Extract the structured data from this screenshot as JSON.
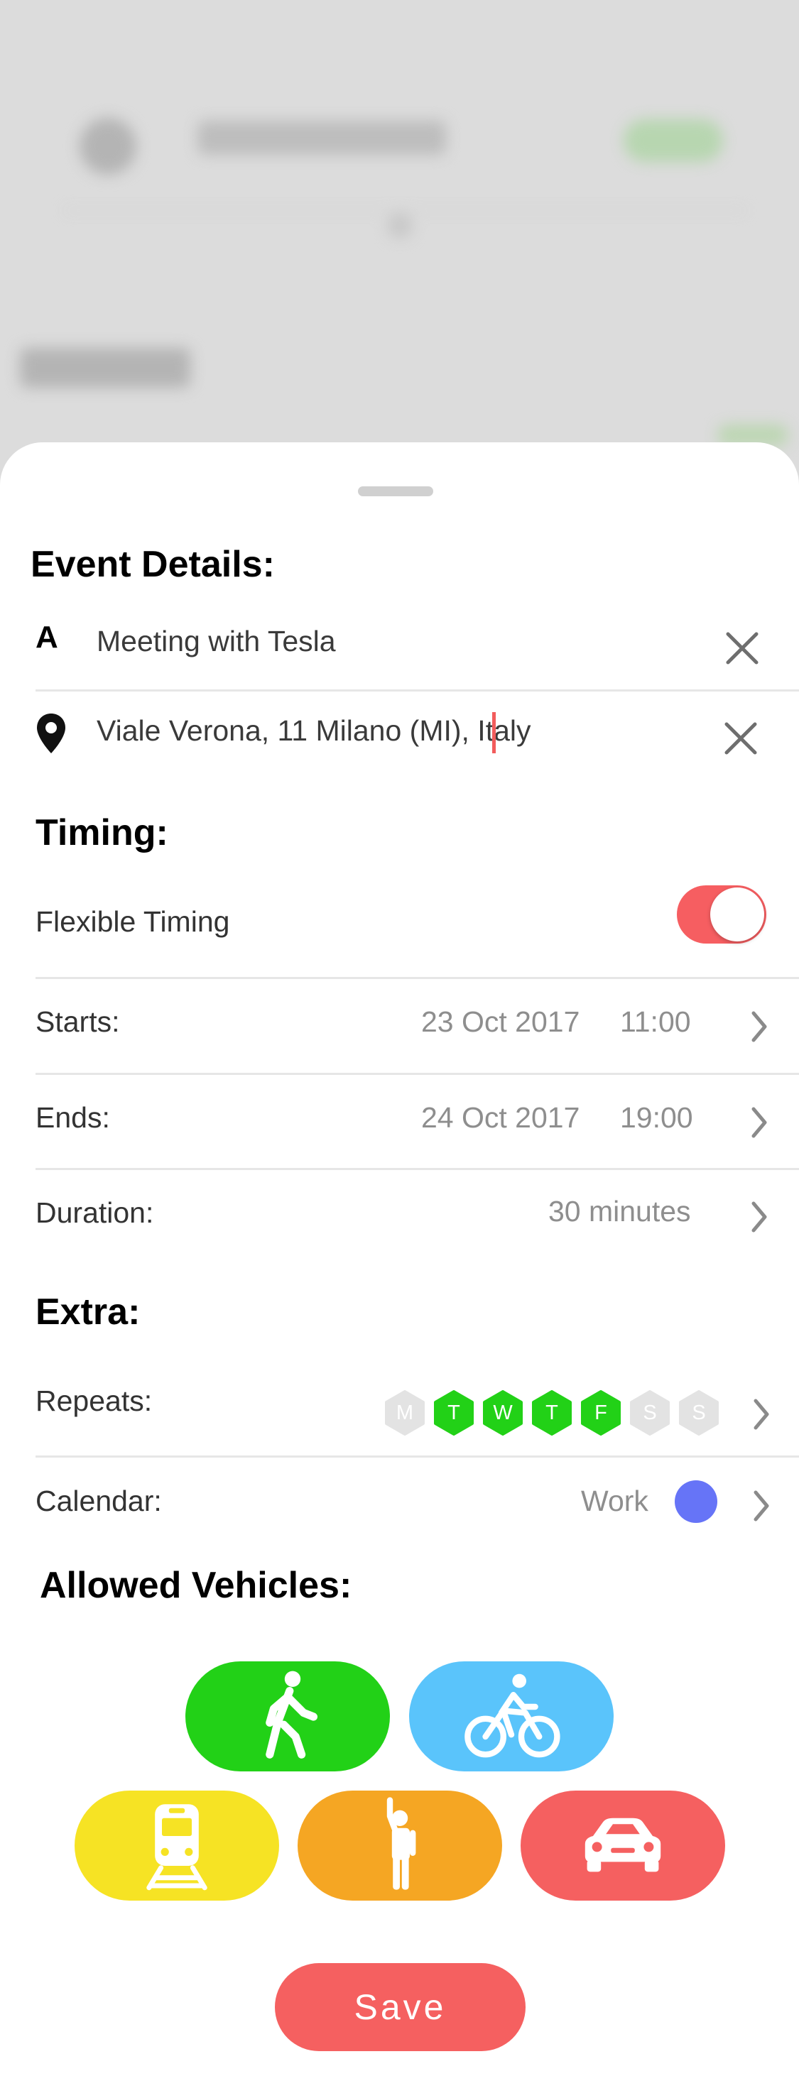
{
  "event_details": {
    "title": "Event Details:",
    "name_icon": "A",
    "name_value": "Meeting with Tesla",
    "location_value": "Viale Verona, 11 Milano (MI), Italy"
  },
  "timing": {
    "title": "Timing:",
    "flexible_label": "Flexible Timing",
    "flexible_on": true,
    "starts_label": "Starts:",
    "starts_date": "23 Oct 2017",
    "starts_time": "11:00",
    "ends_label": "Ends:",
    "ends_date": "24 Oct 2017",
    "ends_time": "19:00",
    "duration_label": "Duration:",
    "duration_value": "30 minutes"
  },
  "extra": {
    "title": "Extra:",
    "repeats_label": "Repeats:",
    "days": [
      {
        "letter": "M",
        "active": false
      },
      {
        "letter": "T",
        "active": true
      },
      {
        "letter": "W",
        "active": true
      },
      {
        "letter": "T",
        "active": true
      },
      {
        "letter": "F",
        "active": true
      },
      {
        "letter": "S",
        "active": false
      },
      {
        "letter": "S",
        "active": false
      }
    ],
    "calendar_label": "Calendar:",
    "calendar_value": "Work",
    "calendar_color": "#6674f7"
  },
  "vehicles": {
    "title": "Allowed Vehicles:",
    "items": [
      {
        "name": "walk-icon",
        "color": "#22d117"
      },
      {
        "name": "bike-icon",
        "color": "#5ac4fb"
      },
      {
        "name": "train-icon",
        "color": "#f6e324"
      },
      {
        "name": "taxi-icon",
        "color": "#f5a623"
      },
      {
        "name": "car-icon",
        "color": "#f56060"
      }
    ]
  },
  "colors": {
    "accent": "#f65e61",
    "active_day": "#22d117",
    "inactive_day": "#e3e3e3"
  },
  "save_label": "Save"
}
